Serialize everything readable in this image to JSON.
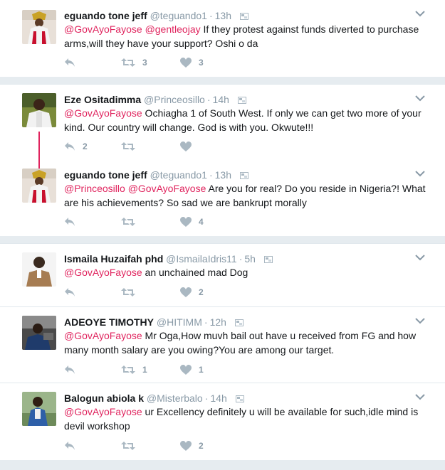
{
  "tweets": [
    {
      "fullname": "eguando tone jeff",
      "handle": "@teguando1",
      "time": "13h",
      "mentions": [
        "@GovAyoFayose",
        "@gentleojay"
      ],
      "text": " If they protest against funds diverted to purchase arms,will they have your support? Oshi o da",
      "reply_count": "",
      "retweet_count": "3",
      "like_count": "3"
    },
    {
      "fullname": "Eze Ositadimma",
      "handle": "@Princeosillo",
      "time": "14h",
      "mentions": [
        "@GovAyoFayose"
      ],
      "text": " Ochiagha 1 of South West. If only we can get two more of your kind. Our country will change. God is with you. Okwute!!!",
      "reply_count": "2",
      "retweet_count": "",
      "like_count": ""
    },
    {
      "fullname": "eguando tone jeff",
      "handle": "@teguando1",
      "time": "13h",
      "mentions": [
        "@Princeosillo",
        "@GovAyoFayose"
      ],
      "text": "  Are you for real? Do you reside in Nigeria?! What are his achievements? So sad we are bankrupt morally",
      "reply_count": "",
      "retweet_count": "",
      "like_count": "4"
    },
    {
      "fullname": "Ismaila Huzaifah phd",
      "handle": "@IsmailaIdris11",
      "time": "5h",
      "mentions": [
        "@GovAyoFayose"
      ],
      "text": " an unchained mad Dog",
      "reply_count": "",
      "retweet_count": "",
      "like_count": "2"
    },
    {
      "fullname": "ADEOYE TIMOTHY",
      "handle": "@HITIMM",
      "time": "12h",
      "mentions": [
        "@GovAyoFayose"
      ],
      "text": " Mr Oga,How muvh bail out have u received from FG and how many month salary are you owing?You are among our target.",
      "reply_count": "",
      "retweet_count": "1",
      "like_count": "1"
    },
    {
      "fullname": "Balogun abiola k",
      "handle": "@Misterbalo",
      "time": "14h",
      "mentions": [
        "@GovAyoFayose"
      ],
      "text": " ur Excellency definitely u will be available for such,idle mind is devil workshop",
      "reply_count": "",
      "retweet_count": "",
      "like_count": "2"
    }
  ],
  "colors": {
    "mention": "#e0245e",
    "muted": "#8899a6",
    "background": "#e6ecf0"
  },
  "icons": [
    "reply-icon",
    "retweet-icon",
    "like-icon",
    "chevron-down-icon",
    "flag-icon"
  ]
}
